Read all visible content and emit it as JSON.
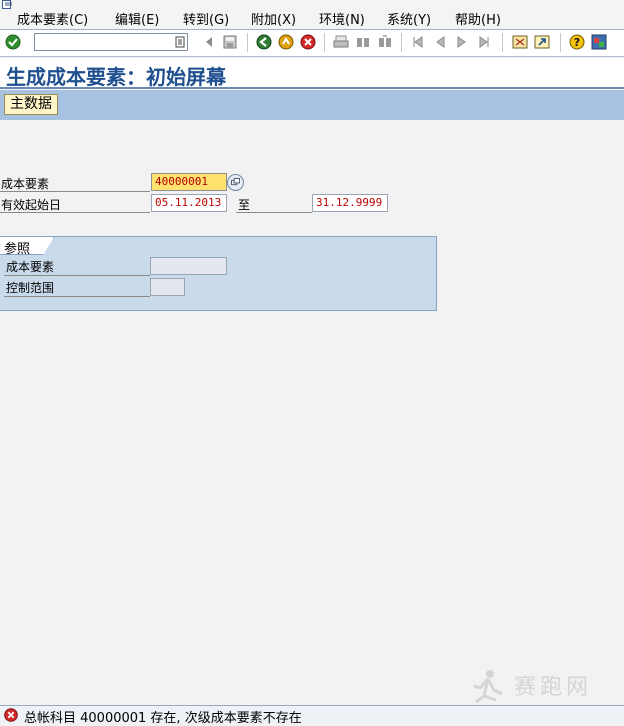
{
  "menu": {
    "items": [
      "成本要素(C)",
      "编辑(E)",
      "转到(G)",
      "附加(X)",
      "环境(N)",
      "系统(Y)",
      "帮助(H)"
    ]
  },
  "toolbar": {
    "command_value": "",
    "icons": [
      "check-icon",
      "dropdown-icon",
      "back-arrow-icon",
      "save-icon",
      "back-icon",
      "exit-icon",
      "cancel-icon",
      "print-icon",
      "find-icon",
      "find-next-icon",
      "first-page-icon",
      "prev-page-icon",
      "next-page-icon",
      "last-page-icon",
      "new-session-icon",
      "shortcut-icon",
      "help-icon",
      "layout-icon"
    ]
  },
  "title": "生成成本要素：初始屏幕",
  "app_toolbar": {
    "master_data_label": "主数据"
  },
  "form": {
    "cost_element_label": "成本要素",
    "cost_element_value": "40000001",
    "valid_from_label": "有效起始日",
    "valid_from_value": "05.11.2013",
    "to_label": "至",
    "valid_to_value": "31.12.9999"
  },
  "reference": {
    "title": "参照",
    "cost_element_label": "成本要素",
    "cost_element_value": "",
    "controlling_area_label": "控制范围",
    "controlling_area_value": ""
  },
  "status": {
    "type": "error",
    "message": "总帐科目 40000001 存在, 次级成本要素不存在"
  },
  "colors": {
    "title": "#1f4f8f",
    "app_toolbar": "#a6c2e0",
    "required_field": "#ffe26d",
    "reference_group": "#c9daeb",
    "error": "#d42a2a"
  }
}
